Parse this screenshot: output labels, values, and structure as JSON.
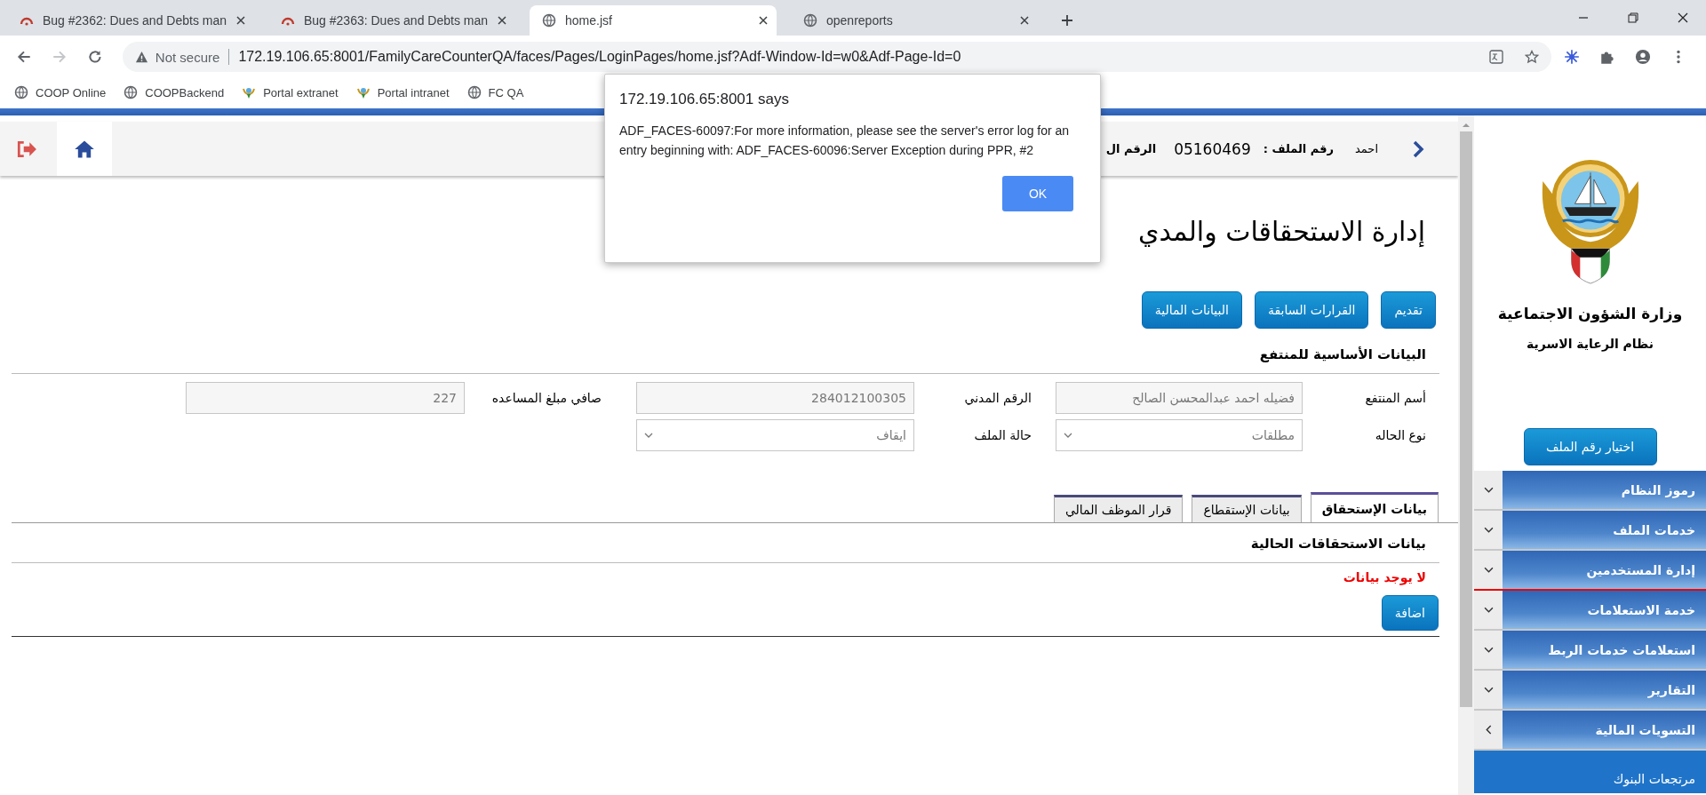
{
  "browser": {
    "tabs": [
      {
        "title": "openreports",
        "kind": "globe",
        "selected": false
      },
      {
        "title": "home.jsf",
        "kind": "globe",
        "selected": true
      },
      {
        "title": "Bug #2363: Dues and Debts man",
        "kind": "bug",
        "selected": false
      },
      {
        "title": "Bug #2362: Dues and Debts man",
        "kind": "bug",
        "selected": false
      }
    ],
    "security_label": "Not secure",
    "url": "172.19.106.65:8001/FamilyCareCounterQA/faces/Pages/LoginPages/home.jsf?Adf-Window-Id=w0&Adf-Page-Id=0",
    "bookmarks": [
      {
        "label": "FC QA",
        "kind": "globe"
      },
      {
        "label": "Portal intranet",
        "kind": "emblem"
      },
      {
        "label": "Portal extranet",
        "kind": "emblem"
      },
      {
        "label": "COOPBackend",
        "kind": "globe"
      },
      {
        "label": "COOP Online",
        "kind": "globe"
      }
    ]
  },
  "dialog": {
    "title": "172.19.106.65:8001 says",
    "message": "ADF_FACES-60097:For more information, please see the server's error log for an entry beginning with: ADF_FACES-60096:Server Exception during PPR, #2",
    "button": "OK"
  },
  "header": {
    "name": "احمد",
    "file_label": "رقم الملف :",
    "file_number": "05160469",
    "civil_label": "الرقم ال"
  },
  "title": "إدارة الاستحقاقات والمدي",
  "actions": [
    "تقديم",
    "القرارات السابقة",
    "البيانات المالية"
  ],
  "basic_section": {
    "heading": "البيانات الأساسية للمنتفع",
    "rows": [
      [
        {
          "label": "أسم المنتفع",
          "value": "فضيله احمد عبدالمحسن الصالح",
          "kind": "text"
        },
        {
          "label": "الرقم المدني",
          "value": "284012100305",
          "kind": "text"
        },
        {
          "label": "صافي مبلغ المساعده",
          "value": "227",
          "kind": "text"
        }
      ],
      [
        {
          "label": "نوع الحاله",
          "value": "مطلقات",
          "kind": "select"
        },
        {
          "label": "حالة الملف",
          "value": "ايقاف",
          "kind": "select"
        }
      ]
    ]
  },
  "tabs": [
    {
      "label": "بيانات الإستحقاق",
      "selected": true
    },
    {
      "label": "بيانات الإستقطاع",
      "selected": false
    },
    {
      "label": "قرار الموظف المالي",
      "selected": false
    }
  ],
  "entitlements": {
    "heading": "بيانات الاستحقاقات الحالية",
    "empty_message": "لا يوجد بيانات",
    "add_button": "اضافة"
  },
  "sidebar": {
    "ministry": "وزارة الشؤون الاجتماعية",
    "system": "نظام الرعاية الاسرية",
    "select_file_button": "اختيار رقم الملف",
    "menu": [
      {
        "label": "رموز النظام",
        "kind": "dropdown",
        "selected": false
      },
      {
        "label": "خدمات الملف",
        "kind": "dropdown",
        "selected": false
      },
      {
        "label": "إدارة المستخدمين",
        "kind": "dropdown",
        "selected": true
      },
      {
        "label": "خدمة الاستعلامات",
        "kind": "dropdown",
        "selected": false
      },
      {
        "label": "استعلامات خدمات الربط",
        "kind": "dropdown",
        "selected": false
      },
      {
        "label": "التقارير",
        "kind": "dropdown",
        "selected": false
      },
      {
        "label": "التسويات المالية",
        "kind": "flyout",
        "selected": false
      },
      {
        "label": "مرتجعات البنوك",
        "kind": "link",
        "selected": false
      }
    ]
  }
}
